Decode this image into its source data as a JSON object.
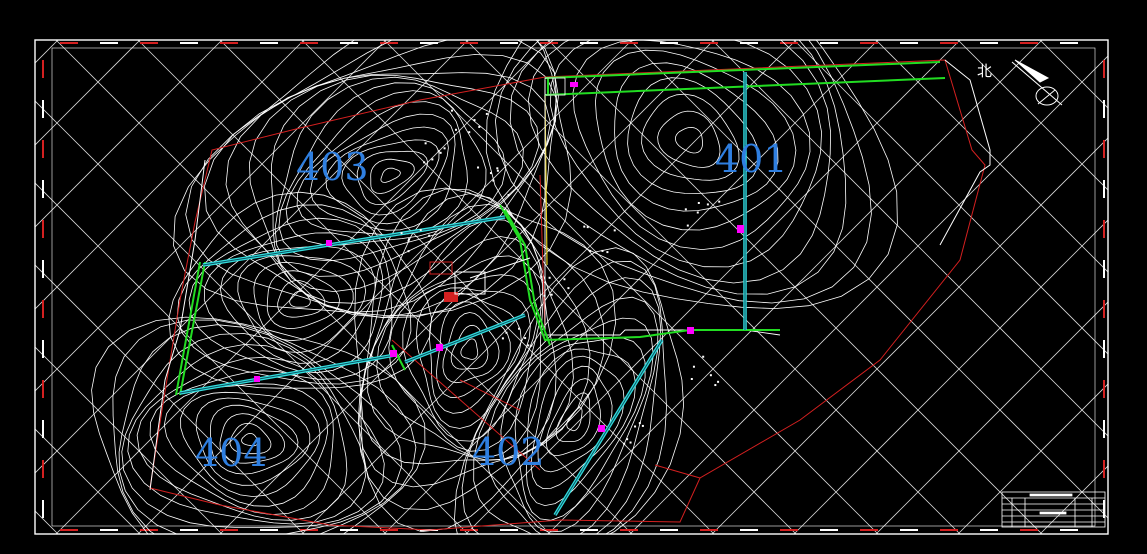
{
  "colors": {
    "background": "#000000",
    "frame": "#ffffff",
    "grid": "#ffffff",
    "contour": "#ffffff",
    "boundary_red": "#d42020",
    "tunnel_green": "#22dd22",
    "tunnel_cyan": "#33dddd",
    "node_magenta": "#ff00ff",
    "label_blue": "#2f7fe0",
    "yellow": "#e8d020"
  },
  "zones": [
    {
      "id": "zone-403",
      "label": "403"
    },
    {
      "id": "zone-401",
      "label": "401"
    },
    {
      "id": "zone-404",
      "label": "404"
    },
    {
      "id": "zone-402",
      "label": "402"
    }
  ],
  "north_arrow": {
    "label": "北",
    "icon": "north-arrow-icon"
  },
  "title_block": {
    "icon": "title-block-table"
  }
}
